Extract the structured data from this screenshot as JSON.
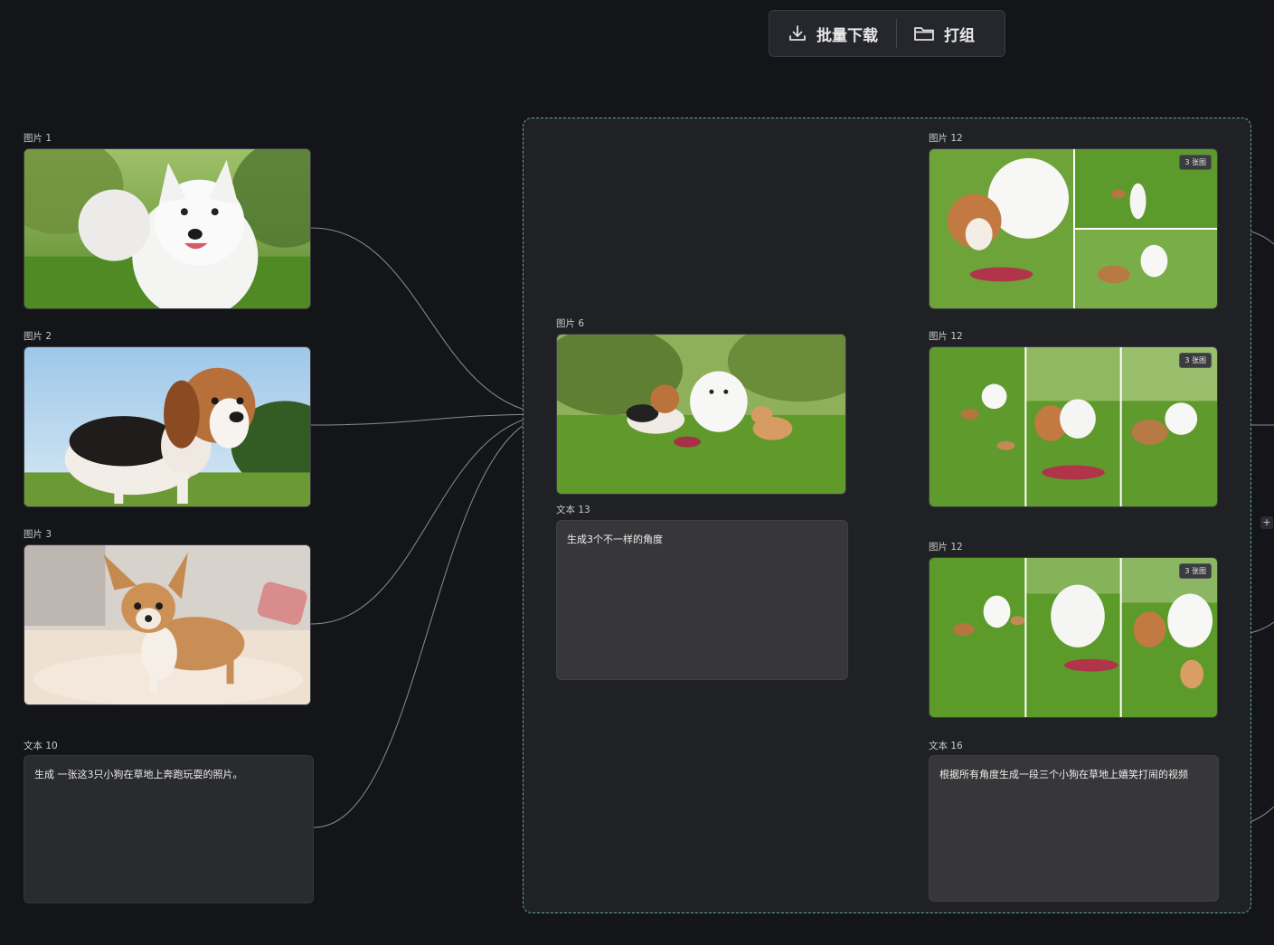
{
  "toolbar": {
    "download_label": "批量下载",
    "group_label": "打组",
    "download_icon": "download-icon",
    "folder_icon": "folder-icon"
  },
  "nodes": {
    "img1_label": "图片 1",
    "img2_label": "图片 2",
    "img3_label": "图片 3",
    "text10_label": "文本 10",
    "text10_content": "生成 一张这3只小狗在草地上奔跑玩耍的照片。",
    "img6_label": "图片 6",
    "text13_label": "文本 13",
    "text13_content": "生成3个不一样的角度",
    "img12a_label": "图片 12",
    "img12b_label": "图片 12",
    "img12c_label": "图片 12",
    "badge_a": "3 张图",
    "badge_b": "3 张图",
    "badge_c": "3 张图",
    "text16_label": "文本 16",
    "text16_content": "根据所有角度生成一段三个小狗在草地上嬉笑打闹的视频"
  },
  "add_button": "+",
  "colors": {
    "canvas_bg": "#141519",
    "group_border": "#5fa59b",
    "wire": "#8b8d93"
  }
}
